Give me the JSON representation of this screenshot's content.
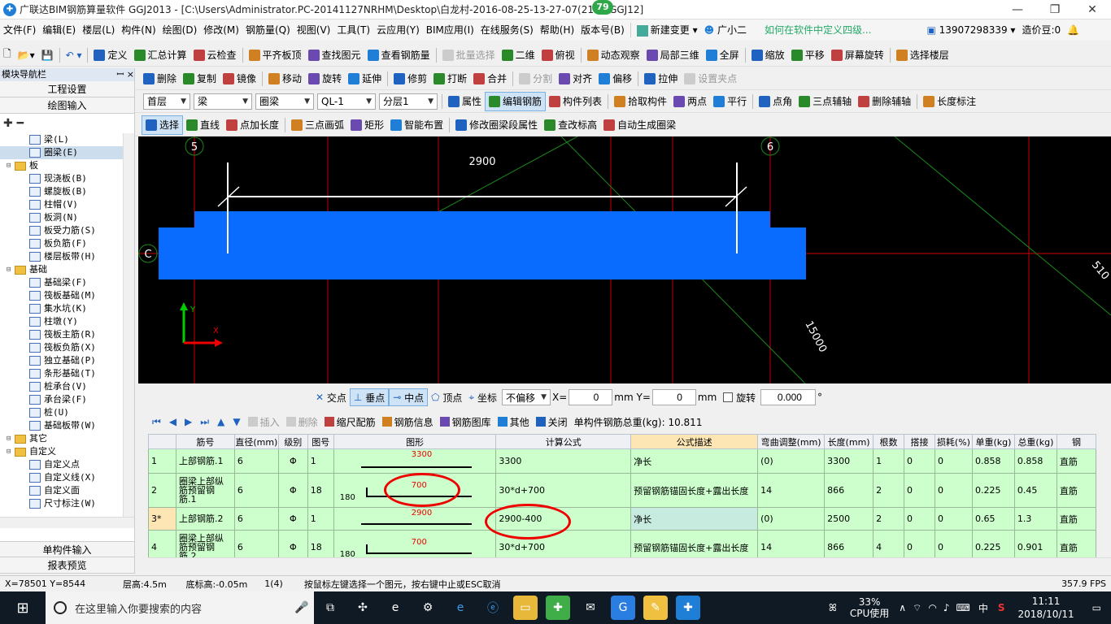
{
  "titlebar": {
    "title": "广联达BIM钢筋算量软件 GGJ2013 - [C:\\Users\\Administrator.PC-20141127NRHM\\Desktop\\白龙村-2016-08-25-13-27-07(21... .GGJ12]",
    "badge": "79",
    "min": "—",
    "restore": "❐",
    "close": "✕"
  },
  "menu": {
    "items": [
      "文件(F)",
      "编辑(E)",
      "楼层(L)",
      "构件(N)",
      "绘图(D)",
      "修改(M)",
      "钢筋量(Q)",
      "视图(V)",
      "工具(T)",
      "云应用(Y)",
      "BIM应用(I)",
      "在线服务(S)",
      "帮助(H)",
      "版本号(B)"
    ],
    "new_change": "新建变更",
    "assistant": "广小二",
    "hint": "如何在软件中定义四级...",
    "phone": "13907298339",
    "price_bean": "造价豆:0"
  },
  "toolbar1": {
    "items": [
      "定义",
      "汇总计算",
      "云检查",
      "平齐板顶",
      "查找图元",
      "查看钢筋量",
      "批量选择",
      "二维",
      "俯视",
      "动态观察",
      "局部三维",
      "全屏",
      "缩放",
      "平移",
      "屏幕旋转",
      "选择楼层"
    ]
  },
  "toolbar2": {
    "items": [
      "删除",
      "复制",
      "镜像",
      "移动",
      "旋转",
      "延伸",
      "修剪",
      "打断",
      "合并",
      "分割",
      "对齐",
      "偏移",
      "拉伸",
      "设置夹点"
    ]
  },
  "toolbar3": {
    "floor": "首层",
    "category": "梁",
    "type": "圈梁",
    "component": "QL-1",
    "layer": "分层1",
    "items": [
      "属性",
      "编辑钢筋",
      "构件列表",
      "拾取构件",
      "两点",
      "平行",
      "点角",
      "三点辅轴",
      "删除辅轴",
      "长度标注"
    ]
  },
  "toolbar4": {
    "items": [
      "选择",
      "直线",
      "点加长度",
      "三点画弧",
      "矩形",
      "智能布置",
      "修改圈梁段属性",
      "查改标高",
      "自动生成圈梁"
    ]
  },
  "nav": {
    "header": "模块导航栏",
    "pin": "ꟷ ×",
    "engineering": "工程设置",
    "drawing": "绘图输入",
    "single_input": "单构件输入",
    "report": "报表预览",
    "tree": [
      {
        "label": "梁(L)",
        "level": 2,
        "kind": "item"
      },
      {
        "label": "圈梁(E)",
        "level": 2,
        "kind": "item",
        "selected": true
      },
      {
        "label": "板",
        "level": 1,
        "kind": "folder"
      },
      {
        "label": "现浇板(B)",
        "level": 2,
        "kind": "item"
      },
      {
        "label": "螺旋板(B)",
        "level": 2,
        "kind": "item"
      },
      {
        "label": "柱帽(V)",
        "level": 2,
        "kind": "item"
      },
      {
        "label": "板洞(N)",
        "level": 2,
        "kind": "item"
      },
      {
        "label": "板受力筋(S)",
        "level": 2,
        "kind": "item"
      },
      {
        "label": "板负筋(F)",
        "level": 2,
        "kind": "item"
      },
      {
        "label": "楼层板带(H)",
        "level": 2,
        "kind": "item"
      },
      {
        "label": "基础",
        "level": 1,
        "kind": "folder"
      },
      {
        "label": "基础梁(F)",
        "level": 2,
        "kind": "item"
      },
      {
        "label": "筏板基础(M)",
        "level": 2,
        "kind": "item"
      },
      {
        "label": "集水坑(K)",
        "level": 2,
        "kind": "item"
      },
      {
        "label": "柱墩(Y)",
        "level": 2,
        "kind": "item"
      },
      {
        "label": "筏板主筋(R)",
        "level": 2,
        "kind": "item"
      },
      {
        "label": "筏板负筋(X)",
        "level": 2,
        "kind": "item"
      },
      {
        "label": "独立基础(P)",
        "level": 2,
        "kind": "item"
      },
      {
        "label": "条形基础(T)",
        "level": 2,
        "kind": "item"
      },
      {
        "label": "桩承台(V)",
        "level": 2,
        "kind": "item"
      },
      {
        "label": "承台梁(F)",
        "level": 2,
        "kind": "item"
      },
      {
        "label": "桩(U)",
        "level": 2,
        "kind": "item"
      },
      {
        "label": "基础板带(W)",
        "level": 2,
        "kind": "item"
      },
      {
        "label": "其它",
        "level": 1,
        "kind": "folder"
      },
      {
        "label": "自定义",
        "level": 1,
        "kind": "folder"
      },
      {
        "label": "自定义点",
        "level": 2,
        "kind": "item"
      },
      {
        "label": "自定义线(X)",
        "level": 2,
        "kind": "item"
      },
      {
        "label": "自定义面",
        "level": 2,
        "kind": "item"
      },
      {
        "label": "尺寸标注(W)",
        "level": 2,
        "kind": "item"
      }
    ]
  },
  "canvas": {
    "axis_5": "5",
    "axis_6": "6",
    "axis_c": "C",
    "dim_top": "2900",
    "dim_diag": "15000",
    "dim_right": "510",
    "y_label": "Y",
    "x_label": "X"
  },
  "snap": {
    "items": [
      "交点",
      "垂点",
      "中点",
      "顶点",
      "坐标"
    ],
    "offset": "不偏移",
    "x_label": "X=",
    "x_value": "0",
    "mm1": "mm",
    "y_label": "Y=",
    "y_value": "0",
    "mm2": "mm",
    "rotate": "旋转",
    "rotate_value": "0.000",
    "deg": "°"
  },
  "rebar_toolbar": {
    "nav": [
      "⏮",
      "◀",
      "▶",
      "⏭",
      "▲",
      "▼"
    ],
    "items": [
      "插入",
      "删除",
      "缩尺配筋",
      "钢筋信息",
      "钢筋图库",
      "其他",
      "关闭"
    ],
    "total": "单构件钢筋总重(kg): 10.811"
  },
  "grid": {
    "headers": [
      "",
      "筋号",
      "直径(mm)",
      "级别",
      "图号",
      "图形",
      "计算公式",
      "公式描述",
      "弯曲调整(mm)",
      "长度(mm)",
      "根数",
      "搭接",
      "损耗(%)",
      "单重(kg)",
      "总重(kg)",
      "钢"
    ],
    "rows": [
      {
        "rn": "1",
        "name": "上部钢筋.1",
        "dia": "6",
        "grade": "Φ",
        "fig": "1",
        "shape_val": "3300",
        "shape_left": "",
        "formula": "3300",
        "desc": "净长",
        "bend": "(0)",
        "len": "3300",
        "count": "1",
        "lap": "0",
        "loss": "0",
        "uw": "0.858",
        "tw": "0.858",
        "type": "直筋"
      },
      {
        "rn": "2",
        "name": "圈梁上部纵筋预留钢筋.1",
        "dia": "6",
        "grade": "Φ",
        "fig": "18",
        "shape_val": "700",
        "shape_left": "180",
        "formula": "30*d+700",
        "desc": "预留钢筋锚固长度+露出长度",
        "bend": "14",
        "len": "866",
        "count": "2",
        "lap": "0",
        "loss": "0",
        "uw": "0.225",
        "tw": "0.45",
        "type": "直筋"
      },
      {
        "rn": "3*",
        "name": "上部钢筋.2",
        "dia": "6",
        "grade": "Φ",
        "fig": "1",
        "shape_val": "2900",
        "shape_left": "",
        "formula": "2900-400",
        "desc": "净长",
        "bend": "(0)",
        "len": "2500",
        "count": "2",
        "lap": "0",
        "loss": "0",
        "uw": "0.65",
        "tw": "1.3",
        "type": "直筋"
      },
      {
        "rn": "4",
        "name": "圈梁上部纵筋预留钢筋.2",
        "dia": "6",
        "grade": "Φ",
        "fig": "18",
        "shape_val": "700",
        "shape_left": "180",
        "formula": "30*d+700",
        "desc": "预留钢筋锚固长度+露出长度",
        "bend": "14",
        "len": "866",
        "count": "4",
        "lap": "0",
        "loss": "0",
        "uw": "0.225",
        "tw": "0.901",
        "type": "直筋"
      }
    ]
  },
  "status": {
    "coords": "X=78501 Y=8544",
    "floor_height": "层高:4.5m",
    "bottom_elev": "底标高:-0.05m",
    "count": "1(4)",
    "message": "按鼠标左键选择一个图元，按右键中止或ESC取消",
    "fps": "357.9 FPS"
  },
  "taskbar": {
    "search_placeholder": "在这里输入你要搜索的内容",
    "cpu": "33%",
    "cpu_label": "CPU使用",
    "ime": "中",
    "time": "11:11",
    "date": "2018/10/11"
  }
}
